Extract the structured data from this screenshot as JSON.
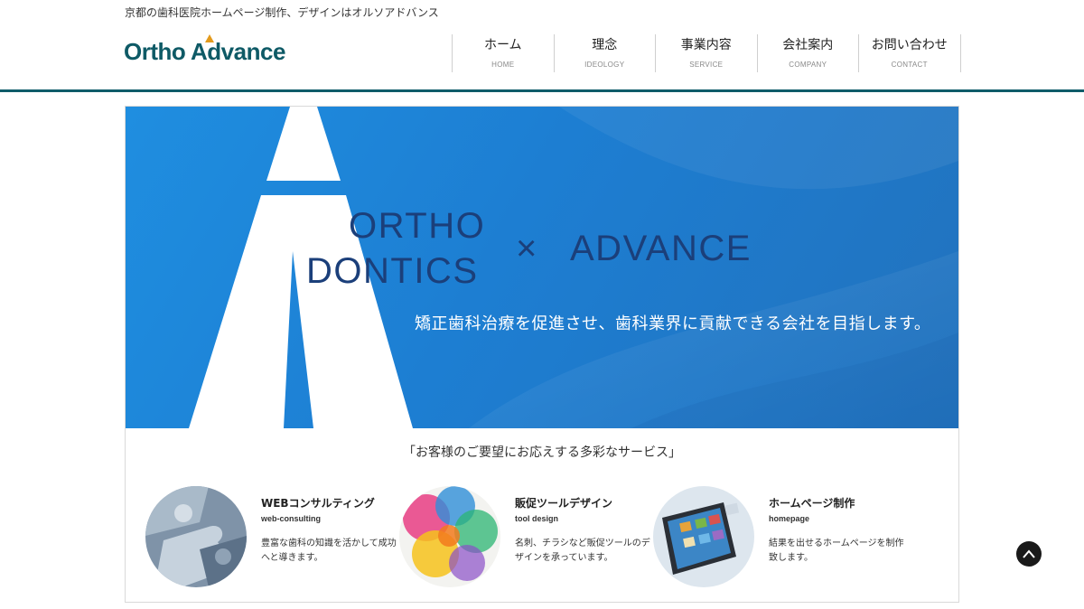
{
  "header": {
    "tagline": "京都の歯科医院ホームページ制作、デザインはオルソアドバンス",
    "logo_text": "Ortho Advance"
  },
  "nav": [
    {
      "jp": "ホーム",
      "en": "HOME"
    },
    {
      "jp": "理念",
      "en": "IDEOLOGY"
    },
    {
      "jp": "事業内容",
      "en": "SERVICE"
    },
    {
      "jp": "会社案内",
      "en": "COMPANY"
    },
    {
      "jp": "お問い合わせ",
      "en": "CONTACT"
    }
  ],
  "hero": {
    "line1": "ORTHO",
    "line2": "DONTICS",
    "cross": "×",
    "advance": "ADVANCE",
    "copy": "矯正歯科治療を促進させ、歯科業界に貢献できる会社を目指します。"
  },
  "services": {
    "heading": "「お客様のご要望にお応えする多彩なサービス」",
    "items": [
      {
        "title": "WEBコンサルティング",
        "sub": "web-consulting",
        "desc": "豊富な歯科の知識を活かして成功へと導きます。"
      },
      {
        "title": "販促ツールデザイン",
        "sub": "tool design",
        "desc": "名刺、チラシなど販促ツールのデザインを承っています。"
      },
      {
        "title": "ホームページ制作",
        "sub": "homepage",
        "desc": "結果を出せるホームページを制作致します。"
      }
    ]
  },
  "colors": {
    "brand": "#0f5c69",
    "accent": "#e39a1c",
    "hero_blue": "#1f8ee0",
    "hero_text": "#1b3f7a"
  },
  "icons": {
    "back_to_top": "chevron-up-icon"
  }
}
